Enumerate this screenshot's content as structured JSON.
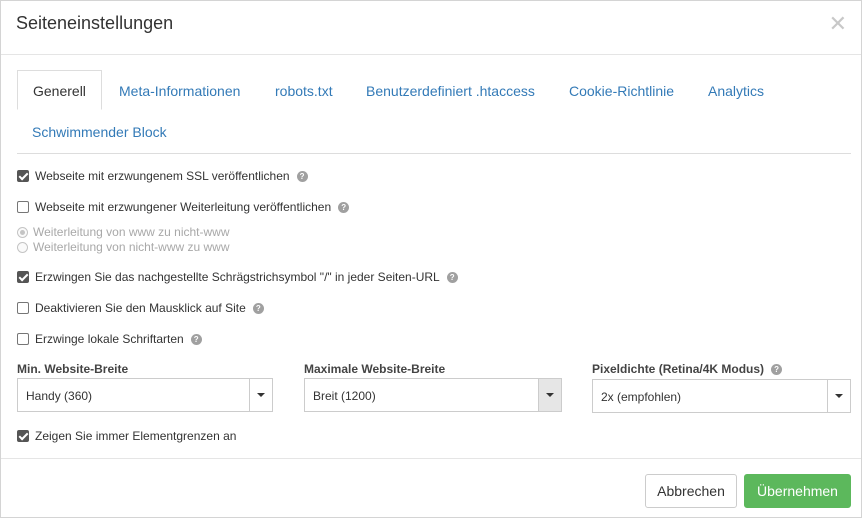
{
  "dialog": {
    "title": "Seiteneinstellungen",
    "close_glyph": "✕"
  },
  "tabs": [
    {
      "label": "Generell",
      "active": true
    },
    {
      "label": "Meta-Informationen"
    },
    {
      "label": "robots.txt"
    },
    {
      "label": "Benutzerdefiniert .htaccess"
    },
    {
      "label": "Cookie-Richtlinie"
    },
    {
      "label": "Analytics"
    },
    {
      "label": "Schwimmender Block"
    }
  ],
  "options": {
    "ssl": {
      "label": "Webseite mit erzwungenem SSL veröffentlichen",
      "checked": true
    },
    "redirect": {
      "label": "Webseite mit erzwungener Weiterleitung veröffentlichen",
      "checked": false
    },
    "radio_www_to_nonwww": {
      "label": "Weiterleitung von www zu nicht-www",
      "checked": true
    },
    "radio_nonwww_to_www": {
      "label": "Weiterleitung von nicht-www zu www",
      "checked": false
    },
    "slash": {
      "label": "Erzwingen Sie das nachgestellte Schrägstrichsymbol \"/\" in jeder Seiten-URL",
      "checked": true
    },
    "mouse": {
      "label": "Deaktivieren Sie den Mausklick auf Site",
      "checked": false
    },
    "fonts": {
      "label": "Erzwinge lokale Schriftarten",
      "checked": false
    },
    "borders": {
      "label": "Zeigen Sie immer Elementgrenzen an",
      "checked": true
    }
  },
  "selects": {
    "min_width": {
      "label": "Min. Website-Breite",
      "value": "Handy (360)"
    },
    "max_width": {
      "label": "Maximale Website-Breite",
      "value": "Breit (1200)"
    },
    "pixel_density": {
      "label": "Pixeldichte (Retina/4K Modus)",
      "value": "2x (empfohlen)"
    }
  },
  "help_glyph": "?",
  "footer": {
    "cancel_label": "Abbrechen",
    "apply_label": "Übernehmen"
  },
  "colors": {
    "link": "#337ab7",
    "apply": "#5cb85c"
  }
}
